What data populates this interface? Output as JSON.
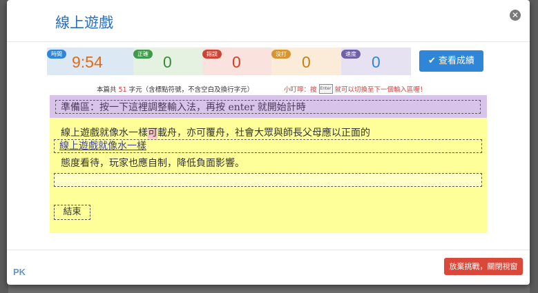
{
  "dialog": {
    "title": "線上遊戲",
    "close_icon": "close-icon"
  },
  "stats": [
    {
      "label": "時間",
      "value": "9:54",
      "badge_color": "#2f86d6",
      "bg": "#dde8f5",
      "value_color": "#e06b15"
    },
    {
      "label": "正確",
      "value": "0",
      "badge_color": "#3f9a4c",
      "bg": "#e5f2e2",
      "value_color": "#3a8a3a"
    },
    {
      "label": "錯誤",
      "value": "0",
      "badge_color": "#cc4433",
      "bg": "#fae3df",
      "value_color": "#dd3b20"
    },
    {
      "label": "沒打",
      "value": "0",
      "badge_color": "#d89430",
      "bg": "#faecd8",
      "value_color": "#c57f12"
    },
    {
      "label": "速度",
      "value": "0",
      "badge_color": "#6e5fa6",
      "bg": "#e6e2f2",
      "value_color": "#2f86d6"
    }
  ],
  "results_button": {
    "label": "查看成績",
    "icon": "check-icon"
  },
  "notice": {
    "prefix": "本篇共",
    "count": "51",
    "suffix": "字元（含標點符號，不含空白及換行字元）"
  },
  "tip": {
    "before": "小叮嚀：按",
    "key_icon": "keyboard-key-icon",
    "key_text": "Enter",
    "after": "就可以切換至下一個輸入區喔！"
  },
  "prep_area": {
    "text": "準備區：按一下這裡調整輸入法，再按 enter 就開始計時"
  },
  "passage": {
    "line1_before": "線上遊戲就像水一樣",
    "line1_highlight": "可",
    "line1_after": "載舟，亦可覆舟，社會大眾與師長父母應以正面的",
    "input1_value": "線上遊戲就像水一樣",
    "line2": "態度看待，玩家也應自制，降低負面影響。",
    "input2_value": ""
  },
  "end_button": {
    "label": "結束"
  },
  "footer": {
    "quit_label": "放棄挑戰，關閉視窗",
    "watermark": "PK"
  }
}
